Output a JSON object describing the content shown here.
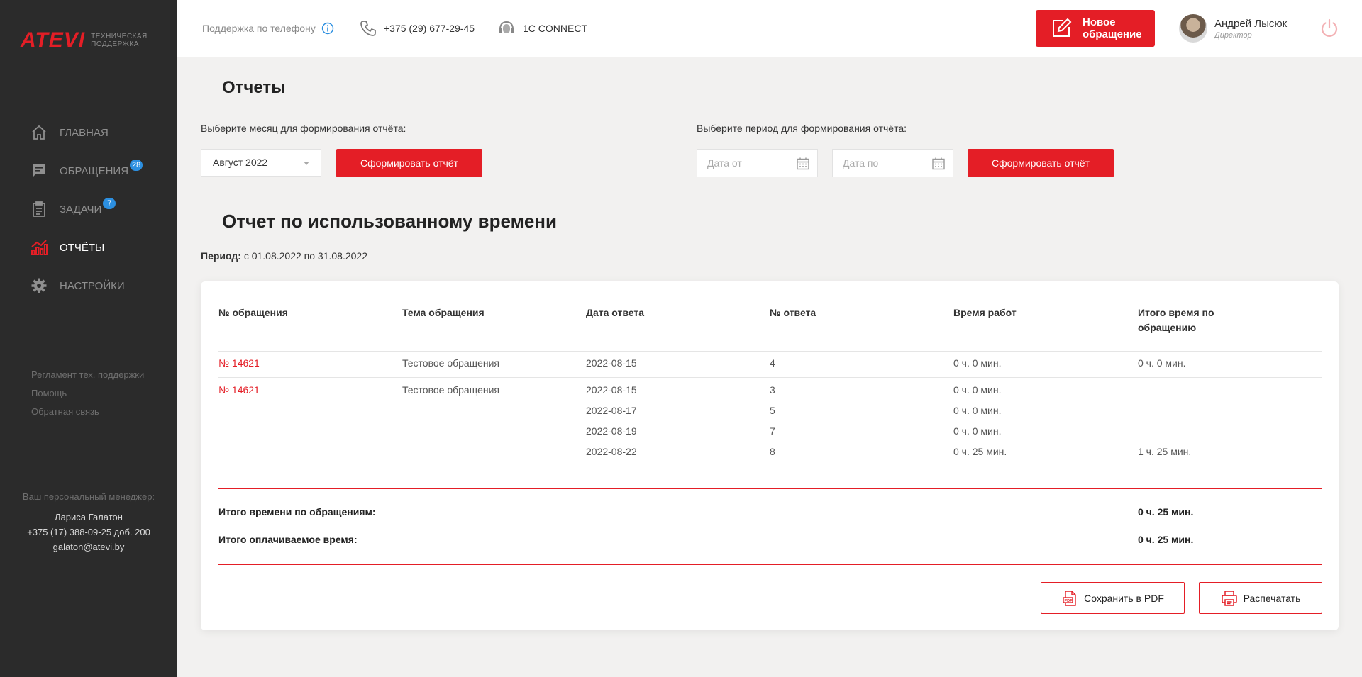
{
  "brand": {
    "logo": "ATEVI",
    "subtitle_line1": "ТЕХНИЧЕСКАЯ",
    "subtitle_line2": "ПОДДЕРЖКА"
  },
  "nav": [
    {
      "label": "ГЛАВНАЯ",
      "icon": "home-icon",
      "badge": ""
    },
    {
      "label": "ОБРАЩЕНИЯ",
      "icon": "chat-icon",
      "badge": "28"
    },
    {
      "label": "ЗАДАЧИ",
      "icon": "clipboard-icon",
      "badge": "7"
    },
    {
      "label": "ОТЧЁТЫ",
      "icon": "chart-icon",
      "badge": "",
      "active": true
    },
    {
      "label": "НАСТРОЙКИ",
      "icon": "gear-icon",
      "badge": ""
    }
  ],
  "side_links": [
    "Регламент тех. поддержки",
    "Помощь",
    "Обратная связь"
  ],
  "manager": {
    "caption": "Ваш персональный менеджер:",
    "name": "Лариса Галатон",
    "phone": "+375 (17) 388-09-25 доб. 200",
    "email": "galaton@atevi.by"
  },
  "topbar": {
    "support_label": "Поддержка по телефону",
    "phone": "+375 (29) 677-29-45",
    "connect": "1С CONNECT",
    "new_request_line1": "Новое",
    "new_request_line2": "обращение",
    "user_name": "Андрей Лысюк",
    "user_role": "Директор"
  },
  "page_title": "Отчеты",
  "month_form": {
    "label": "Выберите месяц для формирования отчёта:",
    "selected": "Август 2022",
    "button": "Сформировать отчёт"
  },
  "period_form": {
    "label": "Выберите период для формирования отчёта:",
    "from_placeholder": "Дата от",
    "to_placeholder": "Дата по",
    "button": "Сформировать отчёт"
  },
  "report": {
    "title": "Отчет по использованному времени",
    "period_label": "Период:",
    "period_value": "с 01.08.2022 по 31.08.2022",
    "columns": [
      "№ обращения",
      "Тема обращения",
      "Дата ответа",
      "№ ответа",
      "Время работ",
      "Итого время по",
      "обращению"
    ],
    "groups": [
      {
        "id": "№ 14621",
        "topic": "Тестовое обращения",
        "rows": [
          {
            "date": "2022-08-15",
            "num": "4",
            "time": "0 ч. 0 мин.",
            "total": "0 ч. 0 мин."
          }
        ]
      },
      {
        "id": "№ 14621",
        "topic": "Тестовое обращения",
        "rows": [
          {
            "date": "2022-08-15",
            "num": "3",
            "time": "0 ч. 0 мин.",
            "total": ""
          },
          {
            "date": "2022-08-17",
            "num": "5",
            "time": "0 ч. 0 мин.",
            "total": ""
          },
          {
            "date": "2022-08-19",
            "num": "7",
            "time": "0 ч. 0 мин.",
            "total": ""
          },
          {
            "date": "2022-08-22",
            "num": "8",
            "time": "0 ч. 25 мин.",
            "total": "1 ч. 25 мин."
          }
        ]
      }
    ],
    "totals": [
      {
        "label": "Итого времени по обращениям:",
        "value": "0 ч. 25 мин."
      },
      {
        "label": "Итого оплачиваемое время:",
        "value": "0 ч. 25 мин."
      }
    ],
    "save_pdf": "Сохранить в PDF",
    "print": "Распечатать"
  },
  "colors": {
    "accent": "#e41e26",
    "sidebar": "#2b2b2b",
    "badge": "#2c8fe0"
  }
}
